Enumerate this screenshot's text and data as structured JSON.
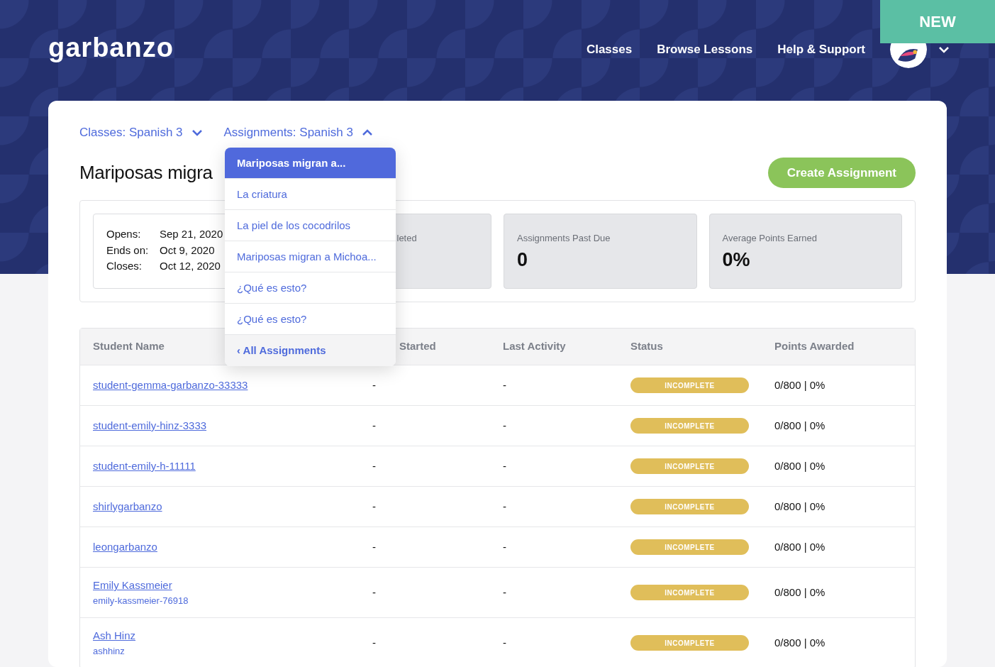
{
  "header": {
    "logo": "garbanzo",
    "nav": [
      "Classes",
      "Browse Lessons",
      "Help & Support"
    ],
    "new_badge": "NEW"
  },
  "breadcrumbs": [
    {
      "label": "Classes: Spanish 3",
      "expanded": false
    },
    {
      "label": "Assignments: Spanish 3",
      "expanded": true
    }
  ],
  "title": "Mariposas migra",
  "create_button": "Create Assignment",
  "dates": [
    {
      "label": "Opens:",
      "value": "Sep 21, 2020"
    },
    {
      "label": "Ends on:",
      "value": "Oct 9, 2020"
    },
    {
      "label": "Closes:",
      "value": "Oct 12, 2020"
    }
  ],
  "stats": [
    {
      "kind": "clipped",
      "label": "leted"
    },
    {
      "kind": "full",
      "label": "Assignments Past Due",
      "value": "0"
    },
    {
      "kind": "full",
      "label": "Average Points Earned",
      "value": "0%"
    }
  ],
  "table": {
    "columns": [
      "Student Name",
      "Started",
      "Last Activity",
      "Status",
      "Points Awarded"
    ],
    "rows": [
      {
        "name": "student-gemma-garbanzo-33333",
        "started": "-",
        "last_activity": "-",
        "status": "INCOMPLETE",
        "points": "0/800 | 0%"
      },
      {
        "name": "student-emily-hinz-3333",
        "started": "-",
        "last_activity": "-",
        "status": "INCOMPLETE",
        "points": "0/800 | 0%"
      },
      {
        "name": "student-emily-h-11111",
        "started": "-",
        "last_activity": "-",
        "status": "INCOMPLETE",
        "points": "0/800 | 0%"
      },
      {
        "name": "shirlygarbanzo",
        "started": "-",
        "last_activity": "-",
        "status": "INCOMPLETE",
        "points": "0/800 | 0%"
      },
      {
        "name": "leongarbanzo",
        "started": "-",
        "last_activity": "-",
        "status": "INCOMPLETE",
        "points": "0/800 | 0%"
      },
      {
        "name": "Emily Kassmeier",
        "username": "emily-kassmeier-76918",
        "started": "-",
        "last_activity": "-",
        "status": "INCOMPLETE",
        "points": "0/800 | 0%"
      },
      {
        "name": "Ash Hinz",
        "username": "ashhinz",
        "started": "-",
        "last_activity": "-",
        "status": "INCOMPLETE",
        "points": "0/800 | 0%"
      }
    ]
  },
  "dropdown": {
    "items": [
      {
        "label": "Mariposas migran a...",
        "selected": true
      },
      {
        "label": "La criatura",
        "selected": false
      },
      {
        "label": "La piel de los cocodrilos",
        "selected": false
      },
      {
        "label": "Mariposas migran a Michoa...",
        "selected": false
      },
      {
        "label": "¿Qué es esto?",
        "selected": false
      },
      {
        "label": "¿Qué es esto?",
        "selected": false
      }
    ],
    "footer": "‹ All Assignments"
  }
}
